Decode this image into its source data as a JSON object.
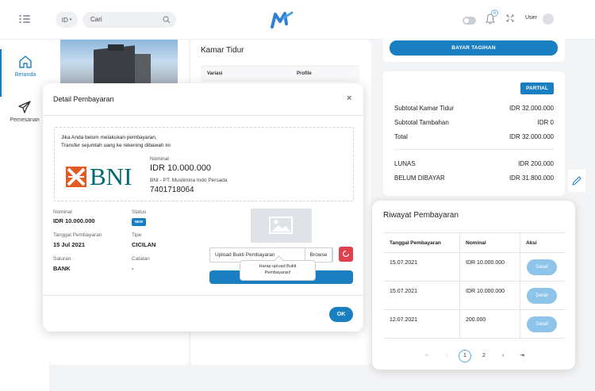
{
  "topbar": {
    "lang": "ID",
    "search_value": "Cari",
    "notification_count": "0",
    "user": "User"
  },
  "sidebar": {
    "items": [
      {
        "label": "Beranda",
        "icon": "home-icon",
        "active": true
      },
      {
        "label": "Pemesanan",
        "icon": "plane-icon",
        "active": false
      }
    ]
  },
  "booking": {
    "kamar_title": "Kamar Tidur",
    "col_variasi": "Variasi",
    "col_profile": "Profile"
  },
  "summary": {
    "bayar_label": "BAYAR TAGIHAN",
    "status": "PARTIAL",
    "rows": [
      {
        "label": "Subtotal Kamar Tidur",
        "value": "IDR 32.000.000"
      },
      {
        "label": "Subtotal Tambahan",
        "value": "IDR 0"
      },
      {
        "label": "Total",
        "value": "IDR 32.000.000"
      },
      {
        "label": "LUNAS",
        "value": "IDR 200.000"
      },
      {
        "label": "BELUM DIBAYAR",
        "value": "IDR 31.800.000"
      }
    ]
  },
  "modal": {
    "title": "Detail Pembayaran",
    "close": "×",
    "instruction_1": "Jika Anda belum melakukan pembayaran,",
    "instruction_2": "Transfer sejumlah uang ke rekening dibawah ini",
    "bank_logo_text": "BNI",
    "nominal_label": "Nominal",
    "nominal_value": "IDR 10.000.000",
    "account_name": "BNI - PT. Muslimina Indo Persada",
    "account_number": "7401718064",
    "details": {
      "nominal_label": "Nominal",
      "nominal_value": "IDR 10.000.000",
      "status_label": "Status",
      "status_badge": "NEW",
      "tanggal_label": "Tanggal Pembayaran",
      "tanggal_value": "15 Jul 2021",
      "tipe_label": "Tipe",
      "tipe_value": "CICILAN",
      "saluran_label": "Saluran",
      "saluran_value": "BANK",
      "catatan_label": "Catatan",
      "catatan_value": "-"
    },
    "upload_placeholder": "Upload Bukti Pembayaran",
    "browse_label": "Browse",
    "tooltip_1": "Harap upload Bukti",
    "tooltip_2": "Pembayaran!",
    "ok_label": "OK"
  },
  "riwayat": {
    "title": "Riwayat Pembayaran",
    "headers": [
      "Tanggal Pembayaran",
      "Nominal",
      "Aksi"
    ],
    "rows": [
      {
        "date": "15.07.2021",
        "amount": "IDR 10.000.000",
        "action": "Detail"
      },
      {
        "date": "15.07.2021",
        "amount": "IDR 10.000.000",
        "action": "Detail"
      },
      {
        "date": "12.07.2021",
        "amount": "200.000",
        "action": "Detail"
      }
    ],
    "pagination": {
      "pages": [
        "1",
        "2"
      ],
      "current": "1"
    }
  },
  "colors": {
    "primary": "#1a7fc1",
    "detail_button": "#8ec4ea",
    "bni_orange": "#e35a24",
    "bni_teal": "#006a71",
    "danger": "#e0414d"
  }
}
